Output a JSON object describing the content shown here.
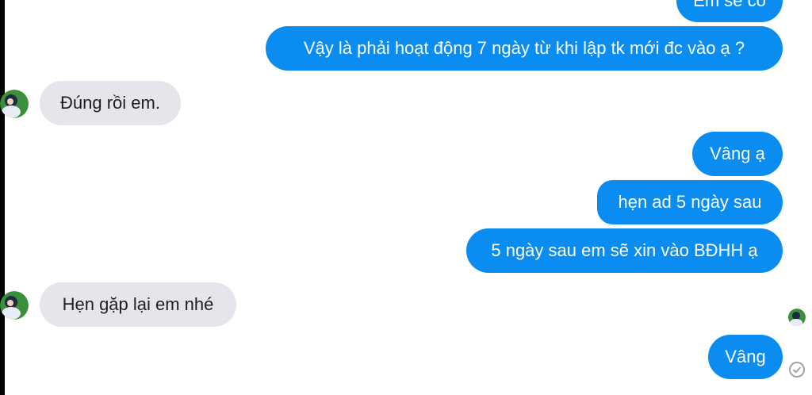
{
  "messages": [
    {
      "text": "Em sẽ có",
      "direction": "outgoing"
    },
    {
      "text": "Vậy là phải hoạt động 7 ngày từ khi lập tk mới đc vào ạ ?",
      "direction": "outgoing"
    },
    {
      "text": "Đúng rồi em.",
      "direction": "incoming"
    },
    {
      "text": "Vâng ạ",
      "direction": "outgoing"
    },
    {
      "text": "hẹn ad 5 ngày sau",
      "direction": "outgoing"
    },
    {
      "text": "5 ngày sau em sẽ xin vào BĐHH ạ",
      "direction": "outgoing"
    },
    {
      "text": "Hẹn gặp lại em nhé",
      "direction": "incoming"
    },
    {
      "text": "Vâng",
      "direction": "outgoing"
    }
  ],
  "icons": {
    "avatar": "avatar-icon",
    "seen": "seen-avatar-icon",
    "sent": "sent-check-icon"
  },
  "colors": {
    "outgoing_bubble": "#0a8cf0",
    "incoming_bubble": "#e4e6eb"
  }
}
